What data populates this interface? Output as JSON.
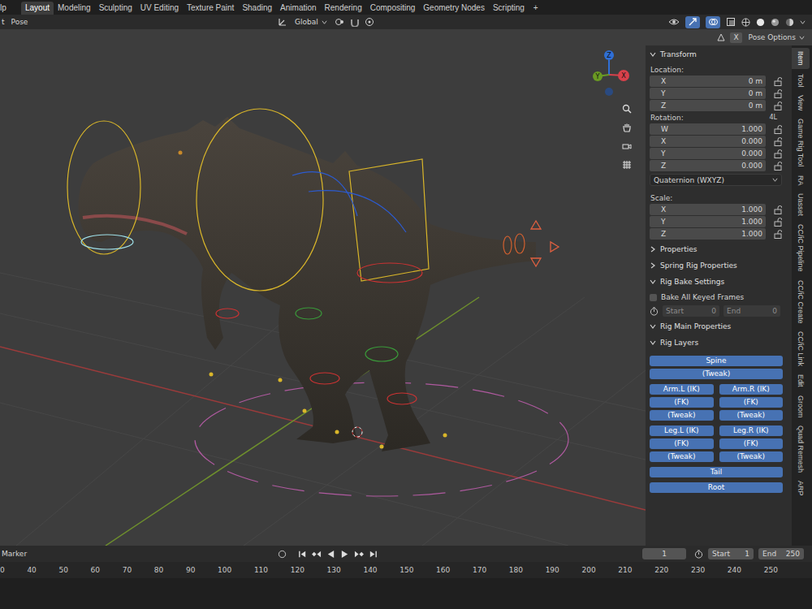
{
  "topbar": {
    "menu_cut": "lp",
    "workspaces": [
      {
        "label": "Layout",
        "selected": true
      },
      {
        "label": "Modeling",
        "selected": false
      },
      {
        "label": "Sculpting",
        "selected": false
      },
      {
        "label": "UV Editing",
        "selected": false
      },
      {
        "label": "Texture Paint",
        "selected": false
      },
      {
        "label": "Shading",
        "selected": false
      },
      {
        "label": "Animation",
        "selected": false
      },
      {
        "label": "Rendering",
        "selected": false
      },
      {
        "label": "Compositing",
        "selected": false
      },
      {
        "label": "Geometry Nodes",
        "selected": false
      },
      {
        "label": "Scripting",
        "selected": false
      }
    ],
    "add_label": "+"
  },
  "header": {
    "menu_cut": "t",
    "mode_menu": "Pose",
    "orientation": "Global"
  },
  "viewport": {
    "gizmo_axes": [
      {
        "label": "Z",
        "color": "#2f6fd6"
      },
      {
        "label": "Y",
        "color": "#6a9a23"
      },
      {
        "label": "X",
        "color": "#d8414b"
      }
    ]
  },
  "tool_options": {
    "toggle": "X",
    "menu": "Pose Options"
  },
  "sidebar": {
    "transform": {
      "title": "Transform",
      "expanded": true,
      "location": {
        "label": "Location:",
        "fields": [
          {
            "axis": "X",
            "value": "0 m",
            "locked": false
          },
          {
            "axis": "Y",
            "value": "0 m",
            "locked": false
          },
          {
            "axis": "Z",
            "value": "0 m",
            "locked": false
          }
        ]
      },
      "rotation": {
        "label": "Rotation:",
        "lock_mode": "4L",
        "fields": [
          {
            "axis": "W",
            "value": "1.000",
            "locked": false
          },
          {
            "axis": "X",
            "value": "0.000",
            "locked": false
          },
          {
            "axis": "Y",
            "value": "0.000",
            "locked": false
          },
          {
            "axis": "Z",
            "value": "0.000",
            "locked": false
          }
        ]
      },
      "rotation_mode": "Quaternion (WXYZ)",
      "scale": {
        "label": "Scale:",
        "fields": [
          {
            "axis": "X",
            "value": "1.000",
            "locked": false
          },
          {
            "axis": "Y",
            "value": "1.000",
            "locked": false
          },
          {
            "axis": "Z",
            "value": "1.000",
            "locked": false
          }
        ]
      }
    },
    "panels": [
      {
        "title": "Properties",
        "expanded": false
      },
      {
        "title": "Spring Rig Properties",
        "expanded": false
      },
      {
        "title": "Rig Bake Settings",
        "expanded": true,
        "bake": {
          "checkbox": {
            "label": "Bake All Keyed Frames",
            "checked": false
          },
          "start": {
            "label": "Start",
            "value": "0"
          },
          "end": {
            "label": "End",
            "value": "0"
          }
        }
      },
      {
        "title": "Rig Main Properties",
        "expanded": true
      },
      {
        "title": "Rig Layers",
        "expanded": true,
        "layers": [
          [
            [
              {
                "label": "Spine",
                "selected": true
              }
            ],
            [
              {
                "label": "(Tweak)",
                "selected": true
              }
            ]
          ],
          [
            [
              {
                "label": "Arm.L (IK)",
                "selected": true
              },
              {
                "label": "Arm.R (IK)",
                "selected": true
              }
            ],
            [
              {
                "label": "(FK)",
                "selected": true
              },
              {
                "label": "(FK)",
                "selected": true
              }
            ],
            [
              {
                "label": "(Tweak)",
                "selected": true
              },
              {
                "label": "(Tweak)",
                "selected": true
              }
            ]
          ],
          [
            [
              {
                "label": "Leg.L (IK)",
                "selected": true
              },
              {
                "label": "Leg.R (IK)",
                "selected": true
              }
            ],
            [
              {
                "label": "(FK)",
                "selected": true
              },
              {
                "label": "(FK)",
                "selected": true
              }
            ],
            [
              {
                "label": "(Tweak)",
                "selected": true
              },
              {
                "label": "(Tweak)",
                "selected": true
              }
            ]
          ],
          [
            [
              {
                "label": "Tail",
                "selected": true
              }
            ]
          ],
          [
            [
              {
                "label": "Root",
                "selected": true
              }
            ]
          ]
        ]
      }
    ]
  },
  "sidebar_tabs": [
    {
      "label": "Item",
      "selected": true
    },
    {
      "label": "Tool",
      "selected": false
    },
    {
      "label": "View",
      "selected": false
    },
    {
      "label": "Game Rig Tool",
      "selected": false
    },
    {
      "label": "RA",
      "selected": false
    },
    {
      "label": "Uasset",
      "selected": false
    },
    {
      "label": "CC/iC Pipeline",
      "selected": false
    },
    {
      "label": "CC/iC Create",
      "selected": false
    },
    {
      "label": "CC/iC Link",
      "selected": false
    },
    {
      "label": "Edit",
      "selected": false
    },
    {
      "label": "Groom",
      "selected": false
    },
    {
      "label": "Quad Remesh",
      "selected": false
    },
    {
      "label": "ARP",
      "selected": false
    }
  ],
  "timeline": {
    "marker_menu": "Marker",
    "current_frame": "1",
    "start": {
      "label": "Start",
      "value": "1"
    },
    "end": {
      "label": "End",
      "value": "250"
    },
    "ruler": [
      "0",
      "40",
      "50",
      "60",
      "70",
      "80",
      "90",
      "100",
      "110",
      "120",
      "130",
      "140",
      "150",
      "160",
      "170",
      "180",
      "190",
      "200",
      "210",
      "220",
      "230",
      "240",
      "250"
    ]
  }
}
